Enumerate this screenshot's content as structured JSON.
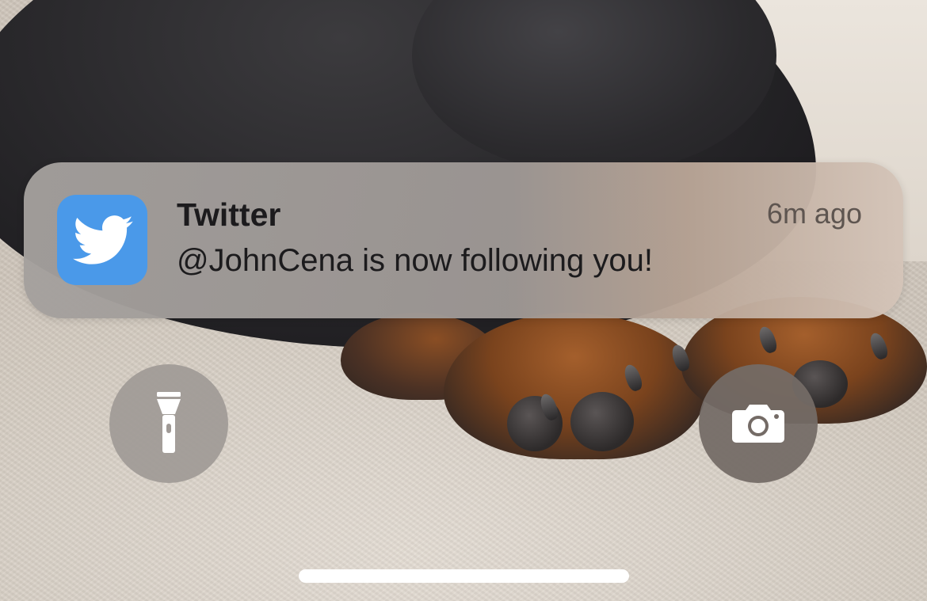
{
  "notification": {
    "app_name": "Twitter",
    "message": "@JohnCena is now following you!",
    "time": "6m ago",
    "app_icon": "twitter-bird-icon",
    "app_icon_color": "#4a99e9"
  },
  "quick_actions": {
    "left": {
      "icon": "flashlight-icon"
    },
    "right": {
      "icon": "camera-icon"
    }
  },
  "home_indicator": {
    "color": "#ffffff"
  }
}
